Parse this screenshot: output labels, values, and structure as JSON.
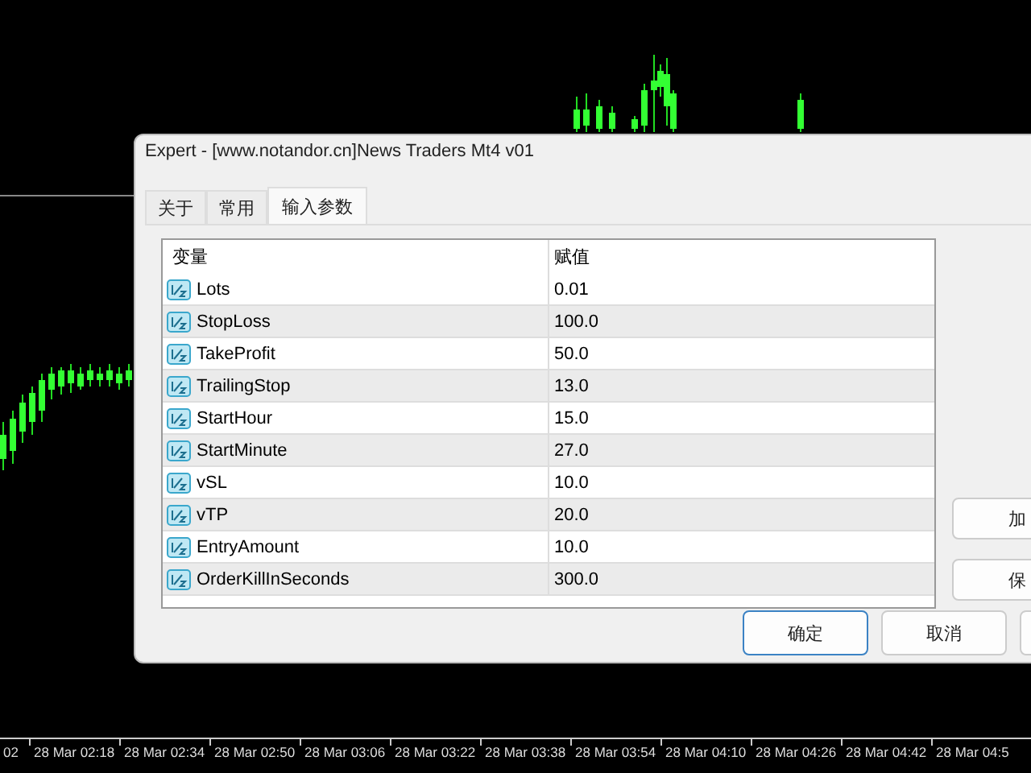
{
  "chart": {
    "time_axis": [
      "02",
      "28 Mar 02:18",
      "28 Mar 02:34",
      "28 Mar 02:50",
      "28 Mar 03:06",
      "28 Mar 03:22",
      "28 Mar 03:38",
      "28 Mar 03:54",
      "28 Mar 04:10",
      "28 Mar 04:26",
      "28 Mar 04:42",
      "28 Mar 04:5"
    ]
  },
  "dialog": {
    "title": "Expert - [www.notandor.cn]News Traders Mt4 v01",
    "tabs": [
      {
        "label": "关于",
        "selected": false
      },
      {
        "label": "常用",
        "selected": false
      },
      {
        "label": "输入参数",
        "selected": true
      }
    ],
    "table": {
      "columns": [
        "变量",
        "赋值"
      ],
      "rows": [
        {
          "name": "Lots",
          "value": "0.01"
        },
        {
          "name": "StopLoss",
          "value": "100.0"
        },
        {
          "name": "TakeProfit",
          "value": "50.0"
        },
        {
          "name": "TrailingStop",
          "value": "13.0"
        },
        {
          "name": "StartHour",
          "value": "15.0"
        },
        {
          "name": "StartMinute",
          "value": "27.0"
        },
        {
          "name": "vSL",
          "value": "10.0"
        },
        {
          "name": "vTP",
          "value": "20.0"
        },
        {
          "name": "EntryAmount",
          "value": "10.0"
        },
        {
          "name": "OrderKillInSeconds",
          "value": "300.0"
        }
      ]
    },
    "side_buttons": [
      "加",
      "保"
    ],
    "buttons": [
      {
        "label": "确定",
        "default": true
      },
      {
        "label": "取消",
        "default": false
      },
      {
        "default": false
      }
    ]
  }
}
